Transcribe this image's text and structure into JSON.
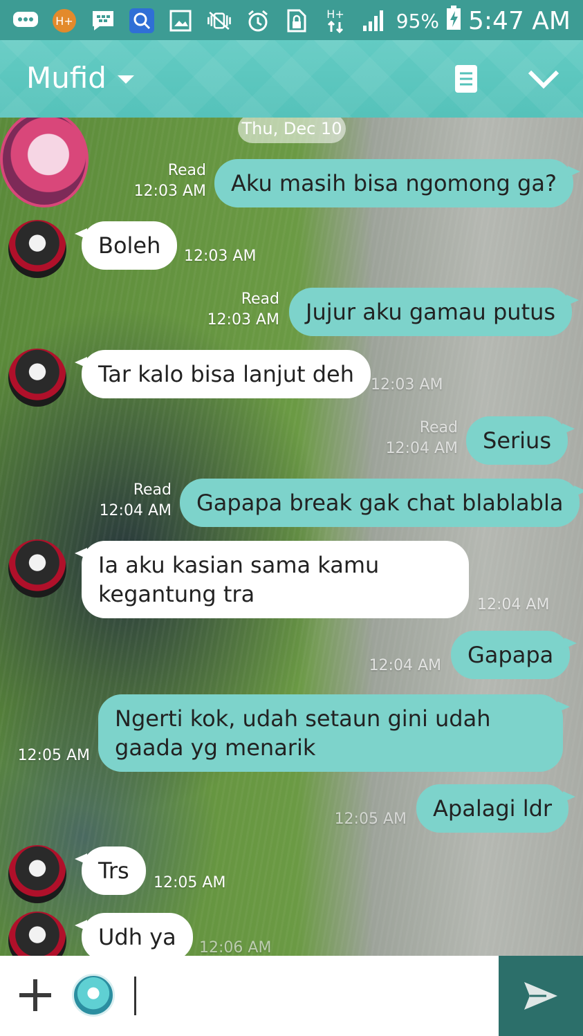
{
  "status_bar": {
    "icons": [
      "message-icon",
      "h-plus-badge-icon",
      "bbm-icon",
      "search-app-icon",
      "gallery-icon",
      "mute-vibrate-icon",
      "alarm-icon",
      "sim-lock-icon",
      "data-arrows-icon",
      "signal-icon"
    ],
    "network": "H+",
    "battery": "95%",
    "time": "5:47 AM"
  },
  "header": {
    "contact_name": "Mufid",
    "icons": [
      "notes-icon",
      "chevron-down-icon"
    ]
  },
  "chat": {
    "date": "Thu, Dec 10",
    "messages": [
      {
        "dir": "out",
        "text": "Aku masih bisa ngomong ga?",
        "read": "Read",
        "time": "12:03 AM"
      },
      {
        "dir": "in",
        "text": "Boleh",
        "time": "12:03 AM"
      },
      {
        "dir": "out",
        "text": "Jujur aku gamau putus",
        "read": "Read",
        "time": "12:03 AM"
      },
      {
        "dir": "in",
        "text": "Tar kalo bisa lanjut deh",
        "time": "12:03 AM"
      },
      {
        "dir": "out",
        "text": "Serius",
        "read": "Read",
        "time": "12:04 AM"
      },
      {
        "dir": "out",
        "text": "Gapapa break gak chat blablabla",
        "read": "Read",
        "time": "12:04 AM"
      },
      {
        "dir": "in",
        "text": "Ia aku kasian sama kamu kegantung tra",
        "time": "12:04 AM"
      },
      {
        "dir": "out",
        "text": "Gapapa",
        "time": "12:04 AM"
      },
      {
        "dir": "out",
        "text": "Ngerti kok, udah setaun gini udah gaada yg menarik",
        "time": "12:05 AM"
      },
      {
        "dir": "out",
        "text": "Apalagi ldr",
        "time": "12:05 AM"
      },
      {
        "dir": "in",
        "text": "Trs",
        "time": "12:05 AM"
      },
      {
        "dir": "in",
        "text": "Udh ya",
        "time": "12:06 AM"
      }
    ]
  },
  "input_bar": {
    "text_value": "",
    "icons": [
      "plus-icon",
      "sticker-icon",
      "send-icon"
    ]
  },
  "colors": {
    "status_bar": "#3d9c94",
    "header": "#5ec7bf",
    "outgoing_bubble": "#7dd3cb",
    "incoming_bubble": "#ffffff",
    "send_button": "#2c6f6a"
  }
}
